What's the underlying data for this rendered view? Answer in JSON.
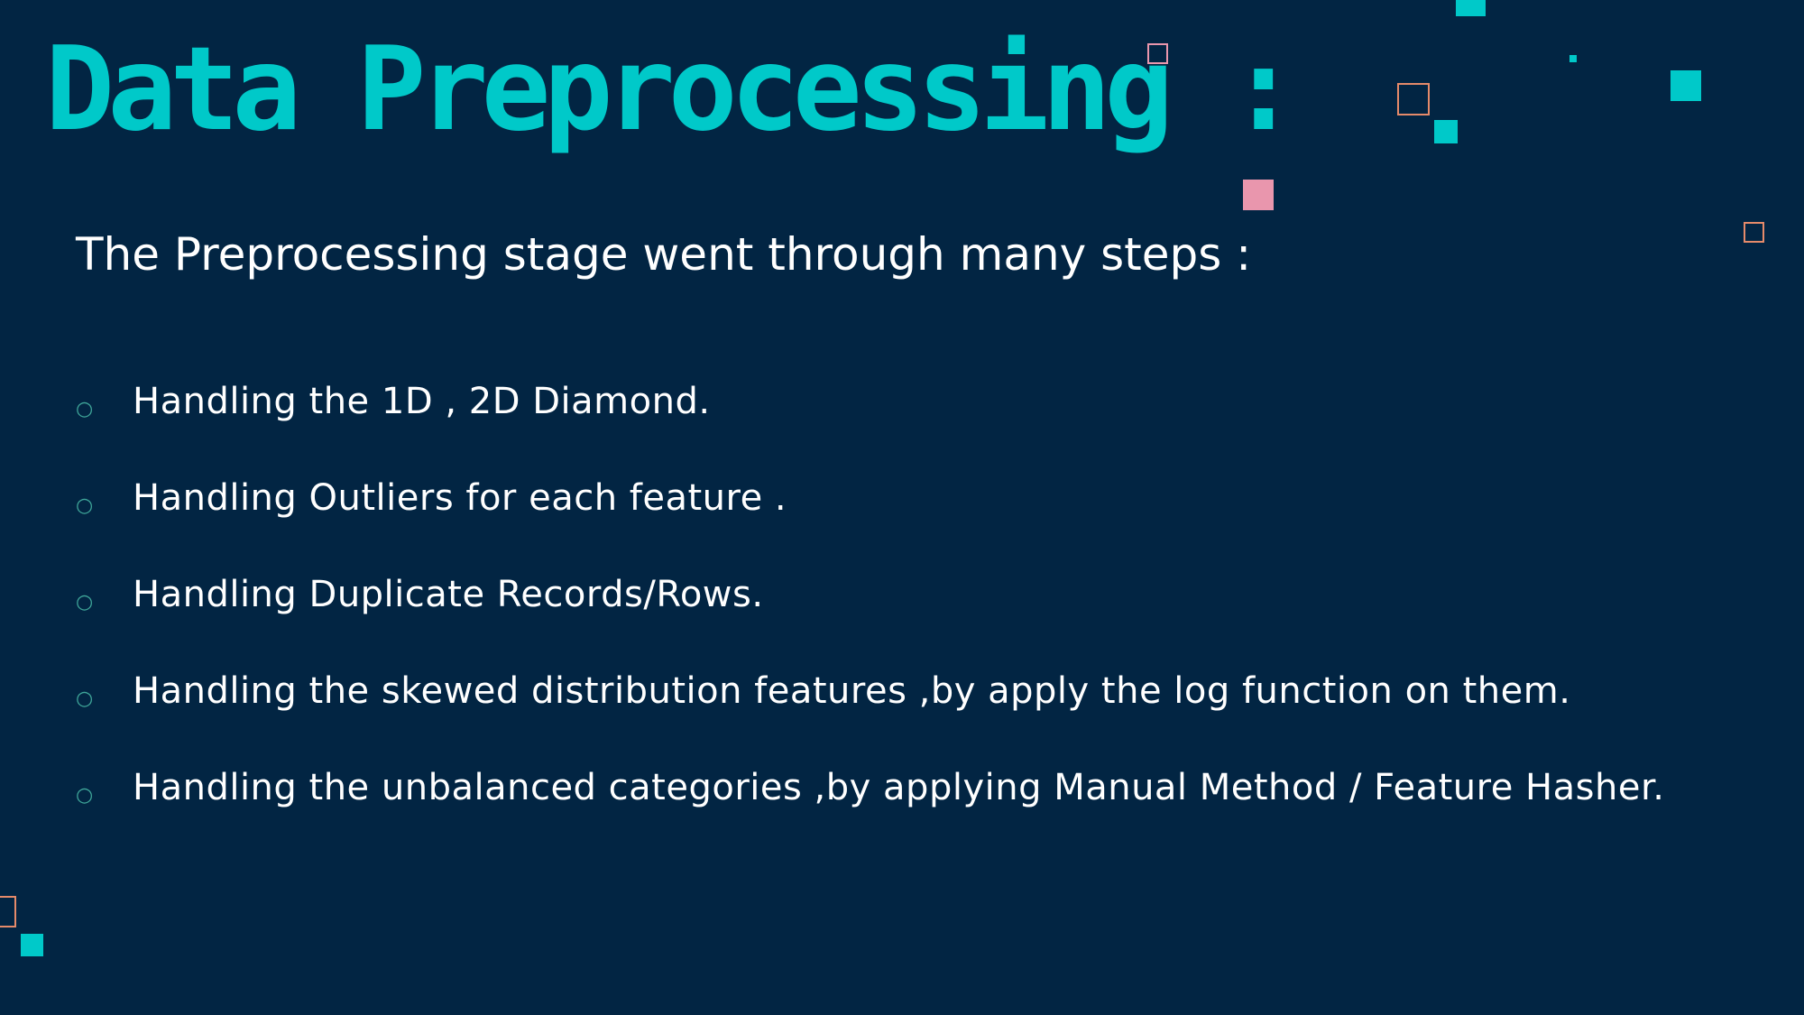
{
  "slide": {
    "title": "Data Preprocessing :",
    "subtitle": "The Preprocessing stage went through many steps :",
    "bullet_marker": "○",
    "bullets": [
      "Handling the 1D , 2D Diamond.",
      "Handling Outliers for each feature .",
      "Handling Duplicate Records/Rows.",
      "Handling the skewed distribution features ,by apply the log function on them.",
      "Handling the unbalanced categories ,by applying Manual Method / Feature Hasher."
    ]
  },
  "colors": {
    "background": "#022543",
    "title": "#00c9c9",
    "text": "#ffffff",
    "bullet_marker": "#3fa79a",
    "accent_teal": "#00c9c9",
    "accent_pink": "#e996ad",
    "accent_orange": "#e58a6a"
  }
}
